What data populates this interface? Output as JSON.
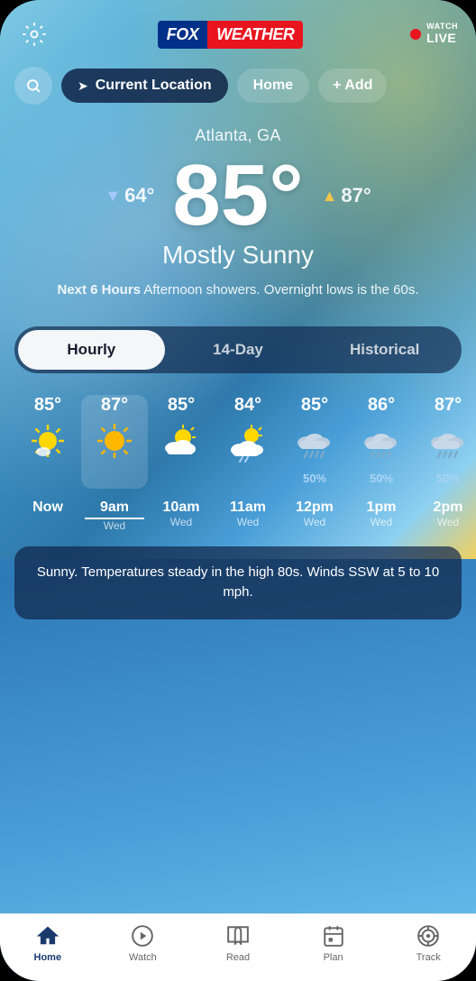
{
  "header": {
    "logo_fox": "FOX",
    "logo_weather": "WEATHER",
    "watch_label": "WATCH",
    "live_label": "LIVE",
    "gear_label": "settings"
  },
  "location_bar": {
    "current_location_label": "Current Location",
    "home_label": "Home",
    "add_label": "+ Add"
  },
  "weather": {
    "city": "Atlanta, GA",
    "temp_current": "85°",
    "temp_low": "64°",
    "temp_high": "87°",
    "condition": "Mostly Sunny",
    "forecast_bold": "Next 6 Hours",
    "forecast_text": " Afternoon showers. Overnight lows is the 60s.",
    "description_card": "Sunny. Temperatures steady in the high 80s. Winds SSW at 5 to 10 mph."
  },
  "tabs": [
    {
      "id": "hourly",
      "label": "Hourly",
      "active": true
    },
    {
      "id": "14day",
      "label": "14-Day",
      "active": false
    },
    {
      "id": "historical",
      "label": "Historical",
      "active": false
    }
  ],
  "hourly": [
    {
      "time_main": "Now",
      "time_sub": "",
      "temp": "85°",
      "icon": "sunny",
      "precip": ""
    },
    {
      "time_main": "9am",
      "time_sub": "Wed",
      "temp": "87°",
      "icon": "sunny_hot",
      "precip": "",
      "highlighted": true
    },
    {
      "time_main": "10am",
      "time_sub": "Wed",
      "temp": "85°",
      "icon": "partly_cloudy",
      "precip": ""
    },
    {
      "time_main": "11am",
      "time_sub": "Wed",
      "temp": "84°",
      "icon": "cloudy_sun",
      "precip": ""
    },
    {
      "time_main": "12pm",
      "time_sub": "Wed",
      "temp": "85°",
      "icon": "rainy",
      "precip": "50%"
    },
    {
      "time_main": "1pm",
      "time_sub": "Wed",
      "temp": "86°",
      "icon": "rainy",
      "precip": "50%"
    },
    {
      "time_main": "2pm",
      "time_sub": "Wed",
      "temp": "87°",
      "icon": "rainy",
      "precip": "50%"
    }
  ],
  "bottom_nav": [
    {
      "id": "home",
      "label": "Home",
      "icon": "home",
      "active": true
    },
    {
      "id": "watch",
      "label": "Watch",
      "icon": "play",
      "active": false
    },
    {
      "id": "read",
      "label": "Read",
      "icon": "book",
      "active": false
    },
    {
      "id": "plan",
      "label": "Plan",
      "icon": "calendar",
      "active": false
    },
    {
      "id": "track",
      "label": "Track",
      "icon": "target",
      "active": false
    }
  ]
}
